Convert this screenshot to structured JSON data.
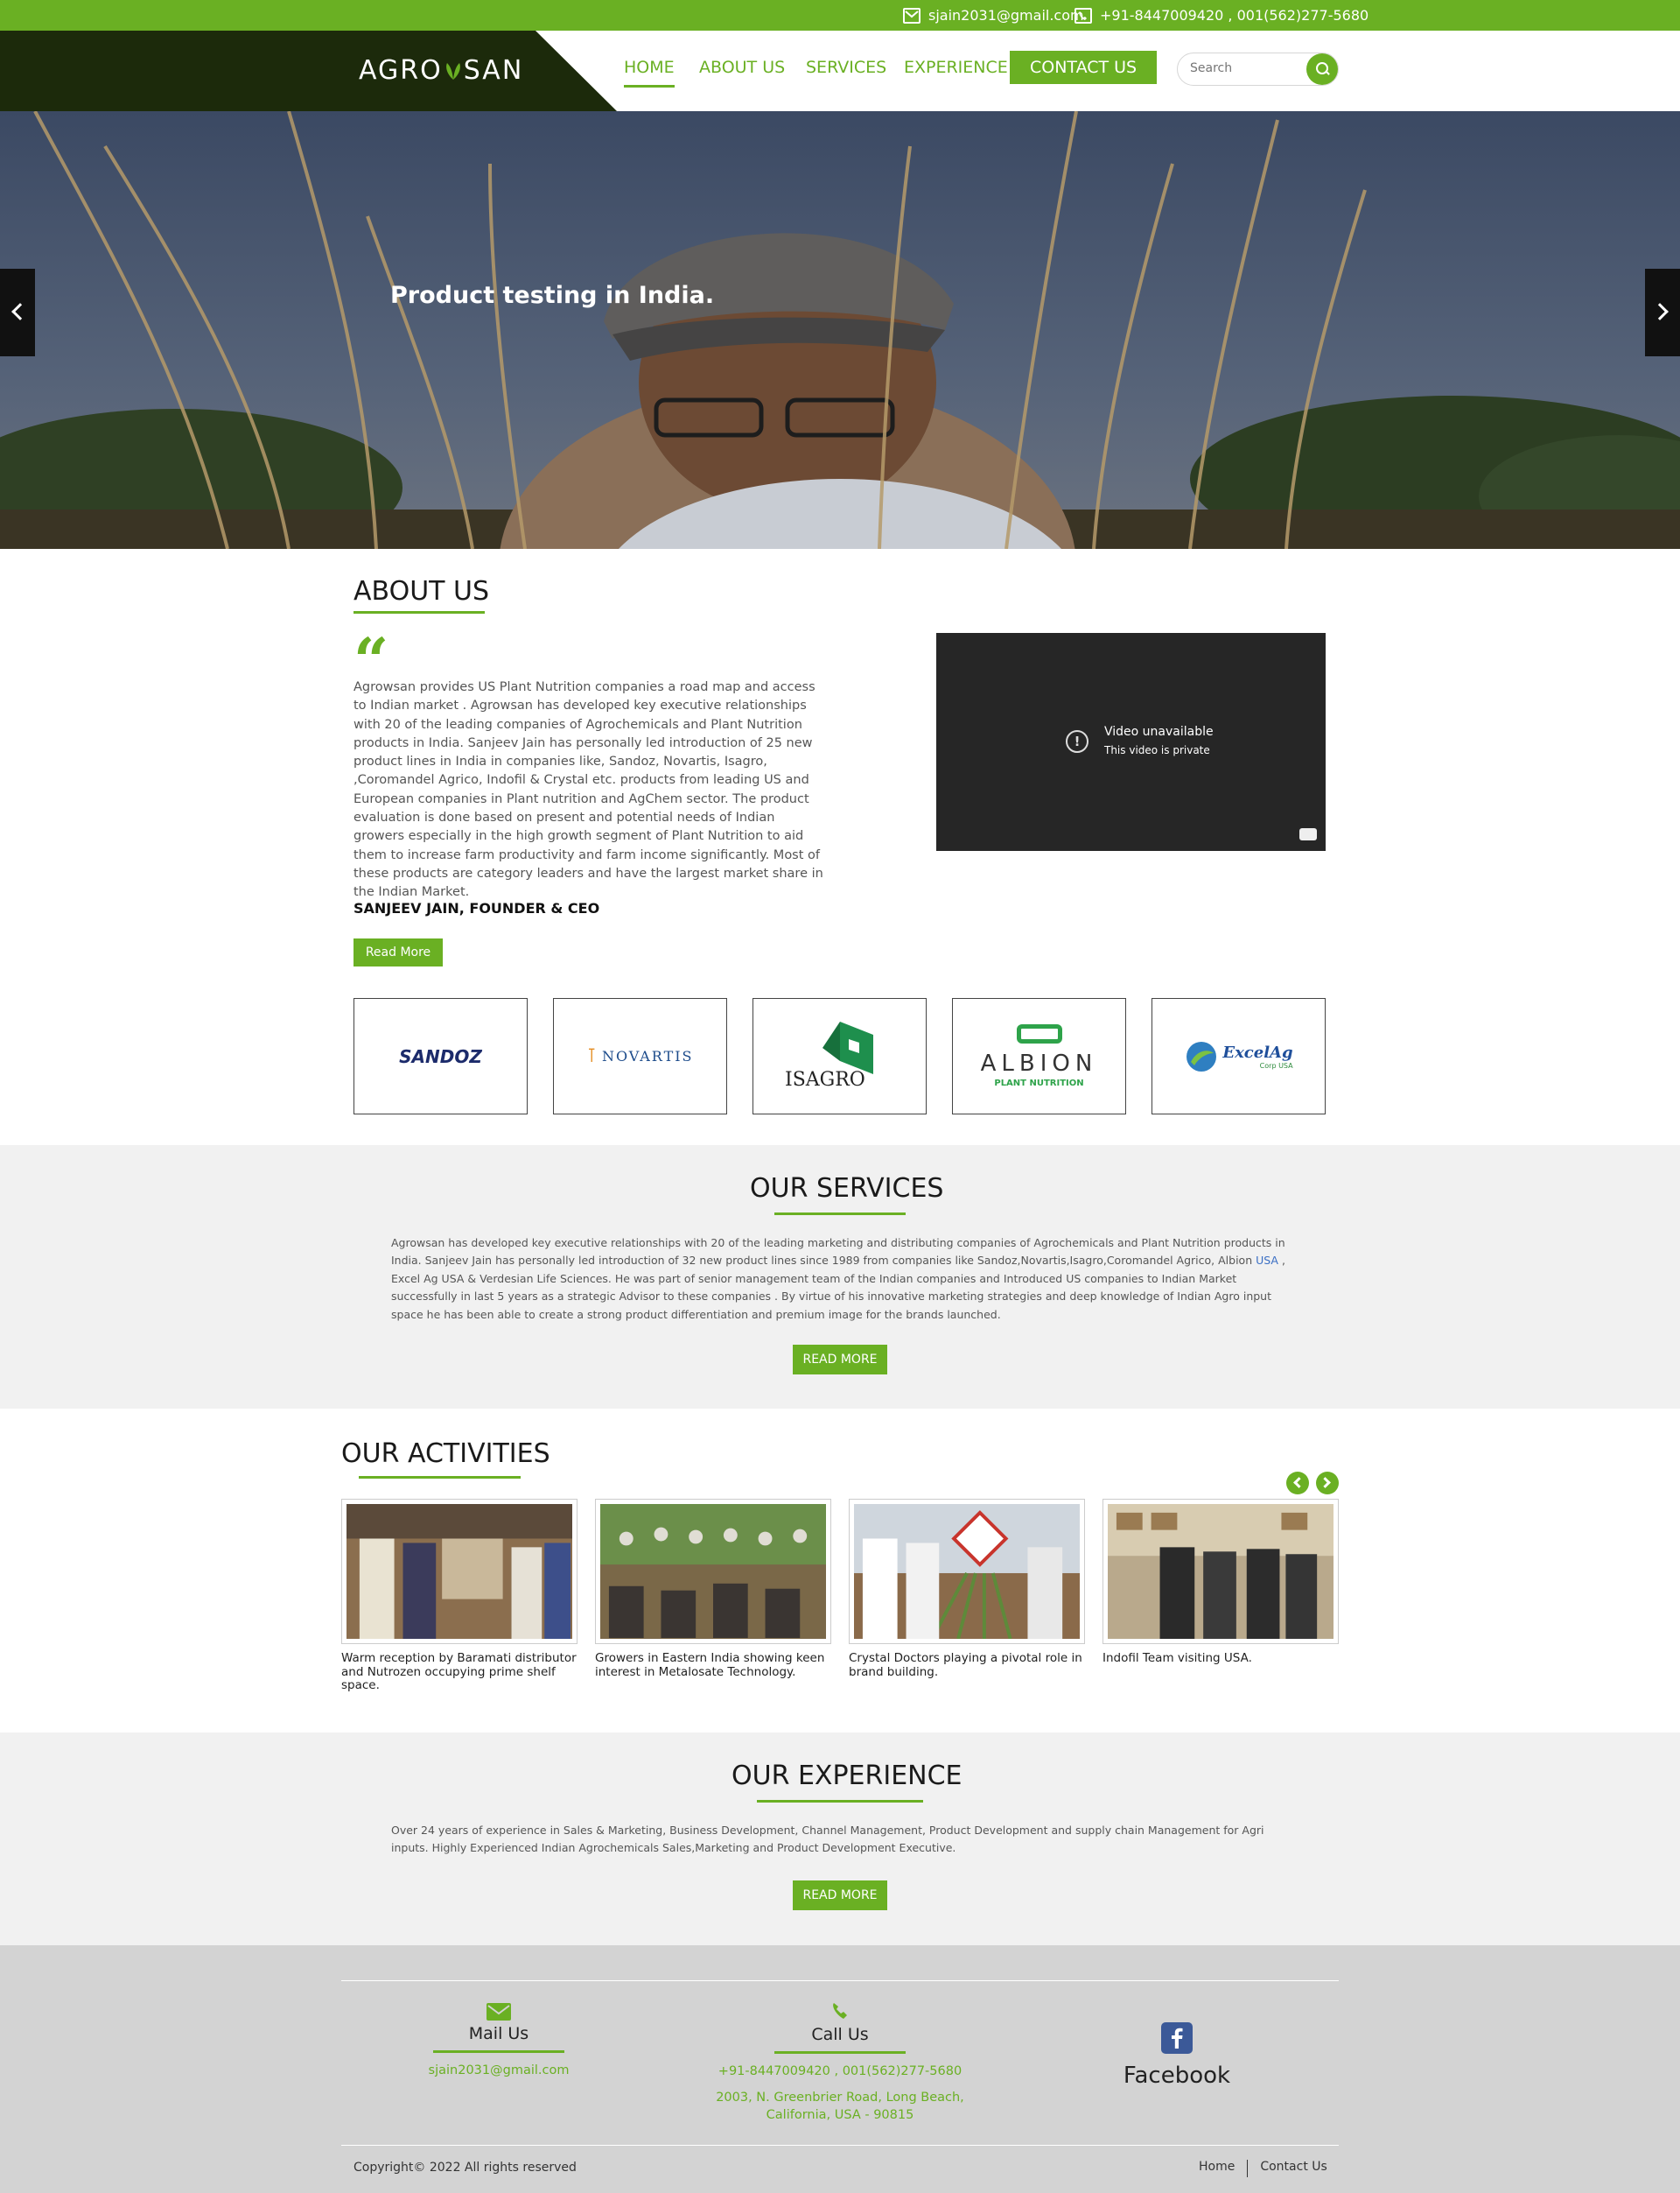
{
  "topbar": {
    "email": "sjain2031@gmail.com",
    "phone": "+91-8447009420 , 001(562)277-5680"
  },
  "header": {
    "logo_left": "AGRO",
    "logo_right": "SAN",
    "nav": {
      "home": "HOME",
      "about": "ABOUT US",
      "services": "SERVICES",
      "experience": "EXPERIENCE",
      "contact": "CONTACT US"
    },
    "search_placeholder": "Search"
  },
  "hero": {
    "caption": "Product testing in India."
  },
  "about": {
    "title": "ABOUT US",
    "quote_mark": "“",
    "text": "Agrowsan provides US Plant Nutrition companies a road map and access to Indian market . Agrowsan has developed key executive relationships with 20 of the leading companies of Agrochemicals and Plant Nutrition products in India. Sanjeev Jain has personally led introduction of 25 new product lines in India in companies like, Sandoz, Novartis, Isagro, ,Coromandel Agrico, Indofil & Crystal etc. products from leading US and European companies in Plant nutrition and AgChem sector. The product evaluation is done based on present and potential needs of Indian growers especially in the high growth segment of Plant Nutrition to aid them to increase farm productivity and farm income significantly. Most of these products are category leaders and have the largest market share in the Indian Market.",
    "founder": "SANJEEV JAIN, FOUNDER & CEO",
    "read_more": "Read More",
    "video": {
      "title": "Video unavailable",
      "subtitle": "This video is private"
    }
  },
  "partners": {
    "sandoz": "SANDOZ",
    "novartis": "NOVARTIS",
    "isagro": "ISAGRO",
    "albion": "ALBION",
    "albion_sub": "PLANT NUTRITION",
    "excel": "ExcelAg",
    "excel_sub": "Corp USA"
  },
  "services": {
    "title": "OUR SERVICES",
    "text_before_link": "Agrowsan has developed key executive relationships with 20 of the leading marketing and distributing companies of Agrochemicals and Plant Nutrition products in India. Sanjeev Jain has personally led introduction of 32 new product lines since 1989 from companies like Sandoz,Novartis,Isagro,Coromandel Agrico, Albion ",
    "link": "USA",
    "text_after_link": " , Excel Ag USA & Verdesian Life Sciences. He was part of senior management team of the Indian companies and Introduced US companies to Indian Market successfully in last 5 years as a strategic Advisor to these companies . By virtue of his innovative marketing strategies and deep knowledge of Indian Agro input space he has been able to create a strong product differentiation and premium image for the brands launched.",
    "read_more": "READ MORE"
  },
  "activities": {
    "title": "OUR ACTIVITIES",
    "items": [
      {
        "caption": "Warm reception by Baramati distributor and Nutrozen occupying prime shelf space."
      },
      {
        "caption": "Growers in Eastern India showing keen interest in Metalosate Technology."
      },
      {
        "caption": "Crystal Doctors playing a pivotal role in brand building."
      },
      {
        "caption": "Indofil Team visiting USA."
      }
    ]
  },
  "experience": {
    "title": "OUR EXPERIENCE",
    "text": "Over 24 years of experience in Sales & Marketing, Business Development, Channel Management, Product Development and supply chain Management for Agri inputs. Highly Experienced Indian Agrochemicals Sales,Marketing and Product Development Executive.",
    "read_more": "READ MORE"
  },
  "footer": {
    "mail_title": "Mail Us",
    "mail_value": "sjain2031@gmail.com",
    "call_title": "Call Us",
    "call_value": "+91-8447009420 , 001(562)277-5680",
    "address": "2003, N. Greenbrier Road, Long Beach, California, USA - 90815",
    "facebook": "Facebook",
    "copyright": "Copyright© 2022 All rights reserved",
    "links": {
      "home": "Home",
      "contact": "Contact Us"
    }
  },
  "colors": {
    "brand_green": "#6ab023",
    "header_dark": "#1c2a0b",
    "section_gray": "#f1f1f1",
    "footer_gray": "#d3d3d3"
  }
}
